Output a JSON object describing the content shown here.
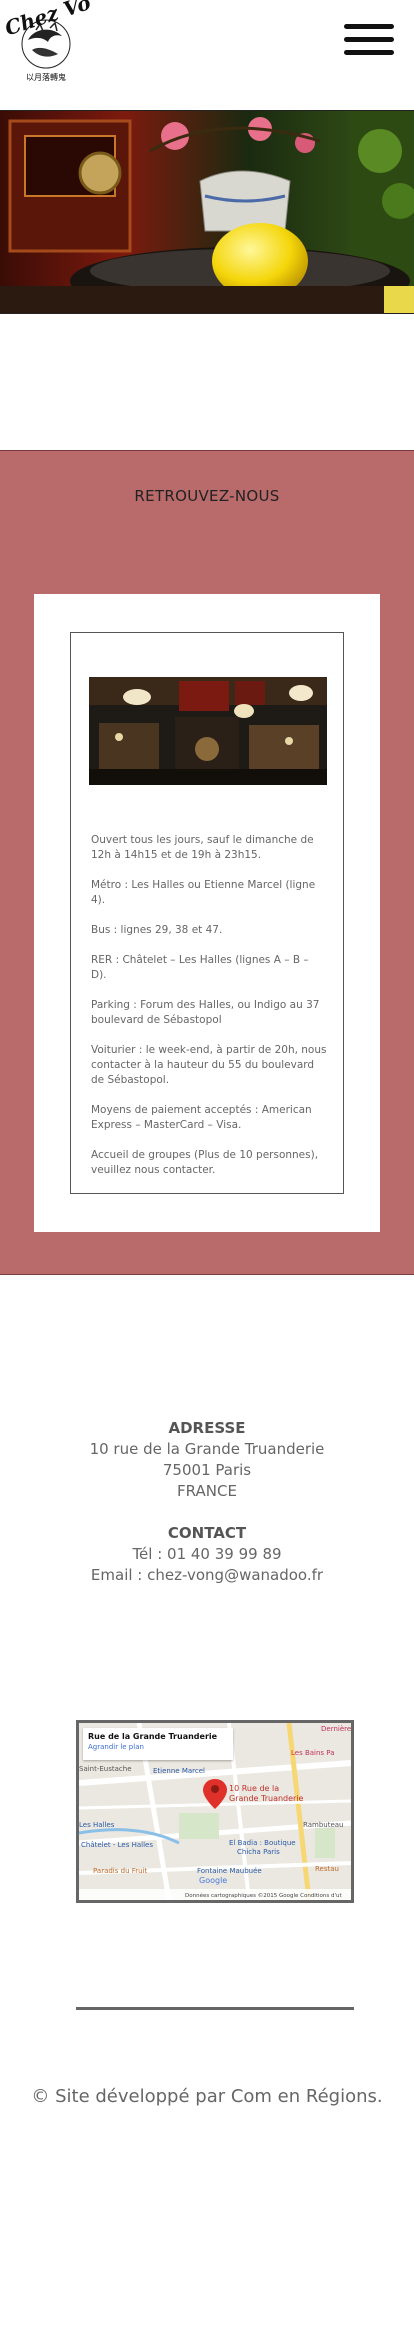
{
  "header": {
    "logo_text": "Chez Vong",
    "logo_subtext": "以月落轉鬼",
    "menu_icon": "hamburger-menu-icon"
  },
  "findus": {
    "title": "RETROUVEZ-NOUS",
    "info": [
      "Ouvert tous les jours, sauf le dimanche de 12h à 14h15 et de 19h à 23h15.",
      "Métro : Les Halles ou Etienne Marcel (ligne 4).",
      "Bus : lignes 29, 38 et 47.",
      "RER : Châtelet – Les Halles (lignes A – B – D).",
      "Parking : Forum des Halles, ou Indigo au 37 boulevard de Sébastopol",
      "Voiturier : le week-end, à partir de 20h, nous contacter à la hauteur du 55 du boulevard de Sébastopol.",
      "Moyens de paiement acceptés : American Express – MasterCard – Visa.",
      "Accueil de groupes (Plus de 10 personnes), veuillez nous contacter."
    ]
  },
  "address": {
    "heading": "ADRESSE",
    "street": "10 rue de la Grande Truanderie",
    "city": "75001 Paris",
    "country": "FRANCE",
    "contact_heading": "CONTACT",
    "phone": "Tél : 01 40 39 99 89",
    "email": "Email : chez-vong@wanadoo.fr"
  },
  "map": {
    "place_title": "Rue de la Grande Truanderie",
    "place_link": "Agrandir le plan",
    "pin_label_1": "10 Rue de la",
    "pin_label_2": "Grande Truanderie",
    "labels": [
      "Saint-Eustache",
      "Etienne Marcel",
      "Les Bains Pa",
      "Les Halles",
      "Châtelet - Les Halles",
      "El Badia : Boutique",
      "Chicha Paris",
      "Rambuteau",
      "Fontaine Maubuée",
      "Restau",
      "Paradis du Fruit",
      "Dernière"
    ],
    "attribution": "Données cartographiques ©2015 Google   Conditions d'ut",
    "google": "Google"
  },
  "footer": {
    "text": "© Site développé par Com en Régions."
  }
}
